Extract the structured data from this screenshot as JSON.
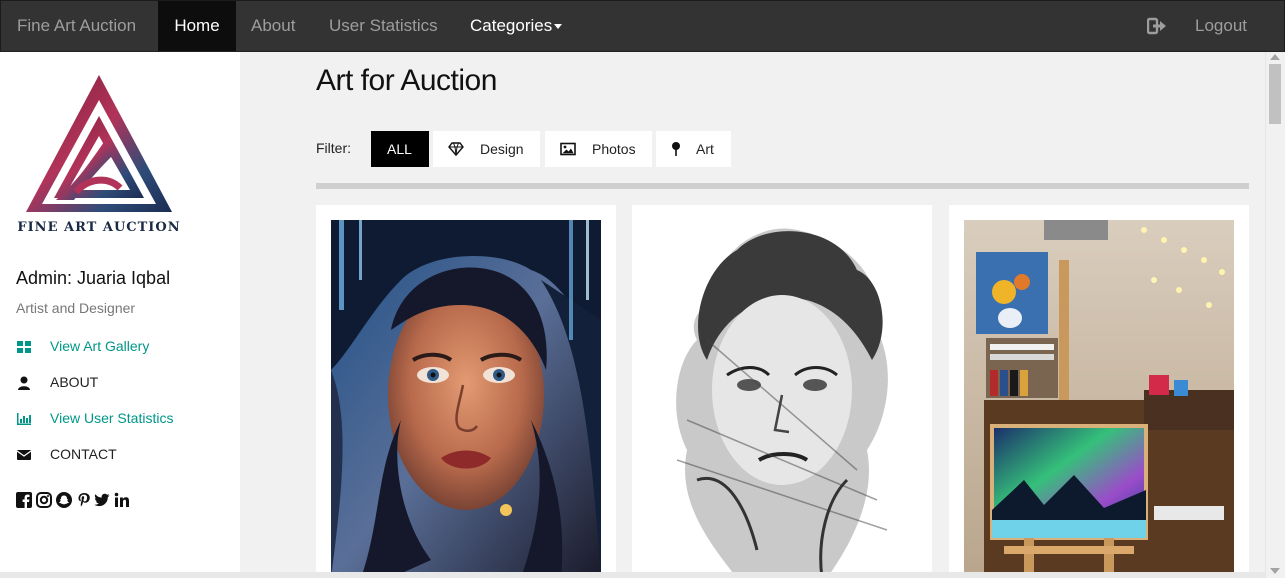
{
  "navbar": {
    "brand": "Fine Art Auction",
    "home": "Home",
    "about": "About",
    "user_statistics": "User Statistics",
    "categories": "Categories",
    "logout": "Logout"
  },
  "sidebar": {
    "logo_text": "FINE ART AUCTION",
    "admin_name": "Admin: Juaria Iqbal",
    "admin_role": "Artist and Designer",
    "links": [
      {
        "label": "View Art Gallery",
        "icon": "grid-icon"
      },
      {
        "label": "ABOUT",
        "icon": "user-icon"
      },
      {
        "label": "View User Statistics",
        "icon": "bar-chart-icon"
      },
      {
        "label": "CONTACT",
        "icon": "envelope-icon"
      }
    ],
    "socials": [
      "facebook-icon",
      "instagram-icon",
      "snapchat-icon",
      "pinterest-icon",
      "twitter-icon",
      "linkedin-icon"
    ]
  },
  "main": {
    "title": "Art for Auction",
    "filter_label": "Filter:",
    "filters": [
      "ALL",
      "Design",
      "Photos",
      "Art"
    ],
    "active_filter": "ALL"
  },
  "colors": {
    "navbar_bg": "#333333",
    "accent_teal": "#009688",
    "active_filter_bg": "#000000",
    "page_bg": "#f1f1f1"
  }
}
